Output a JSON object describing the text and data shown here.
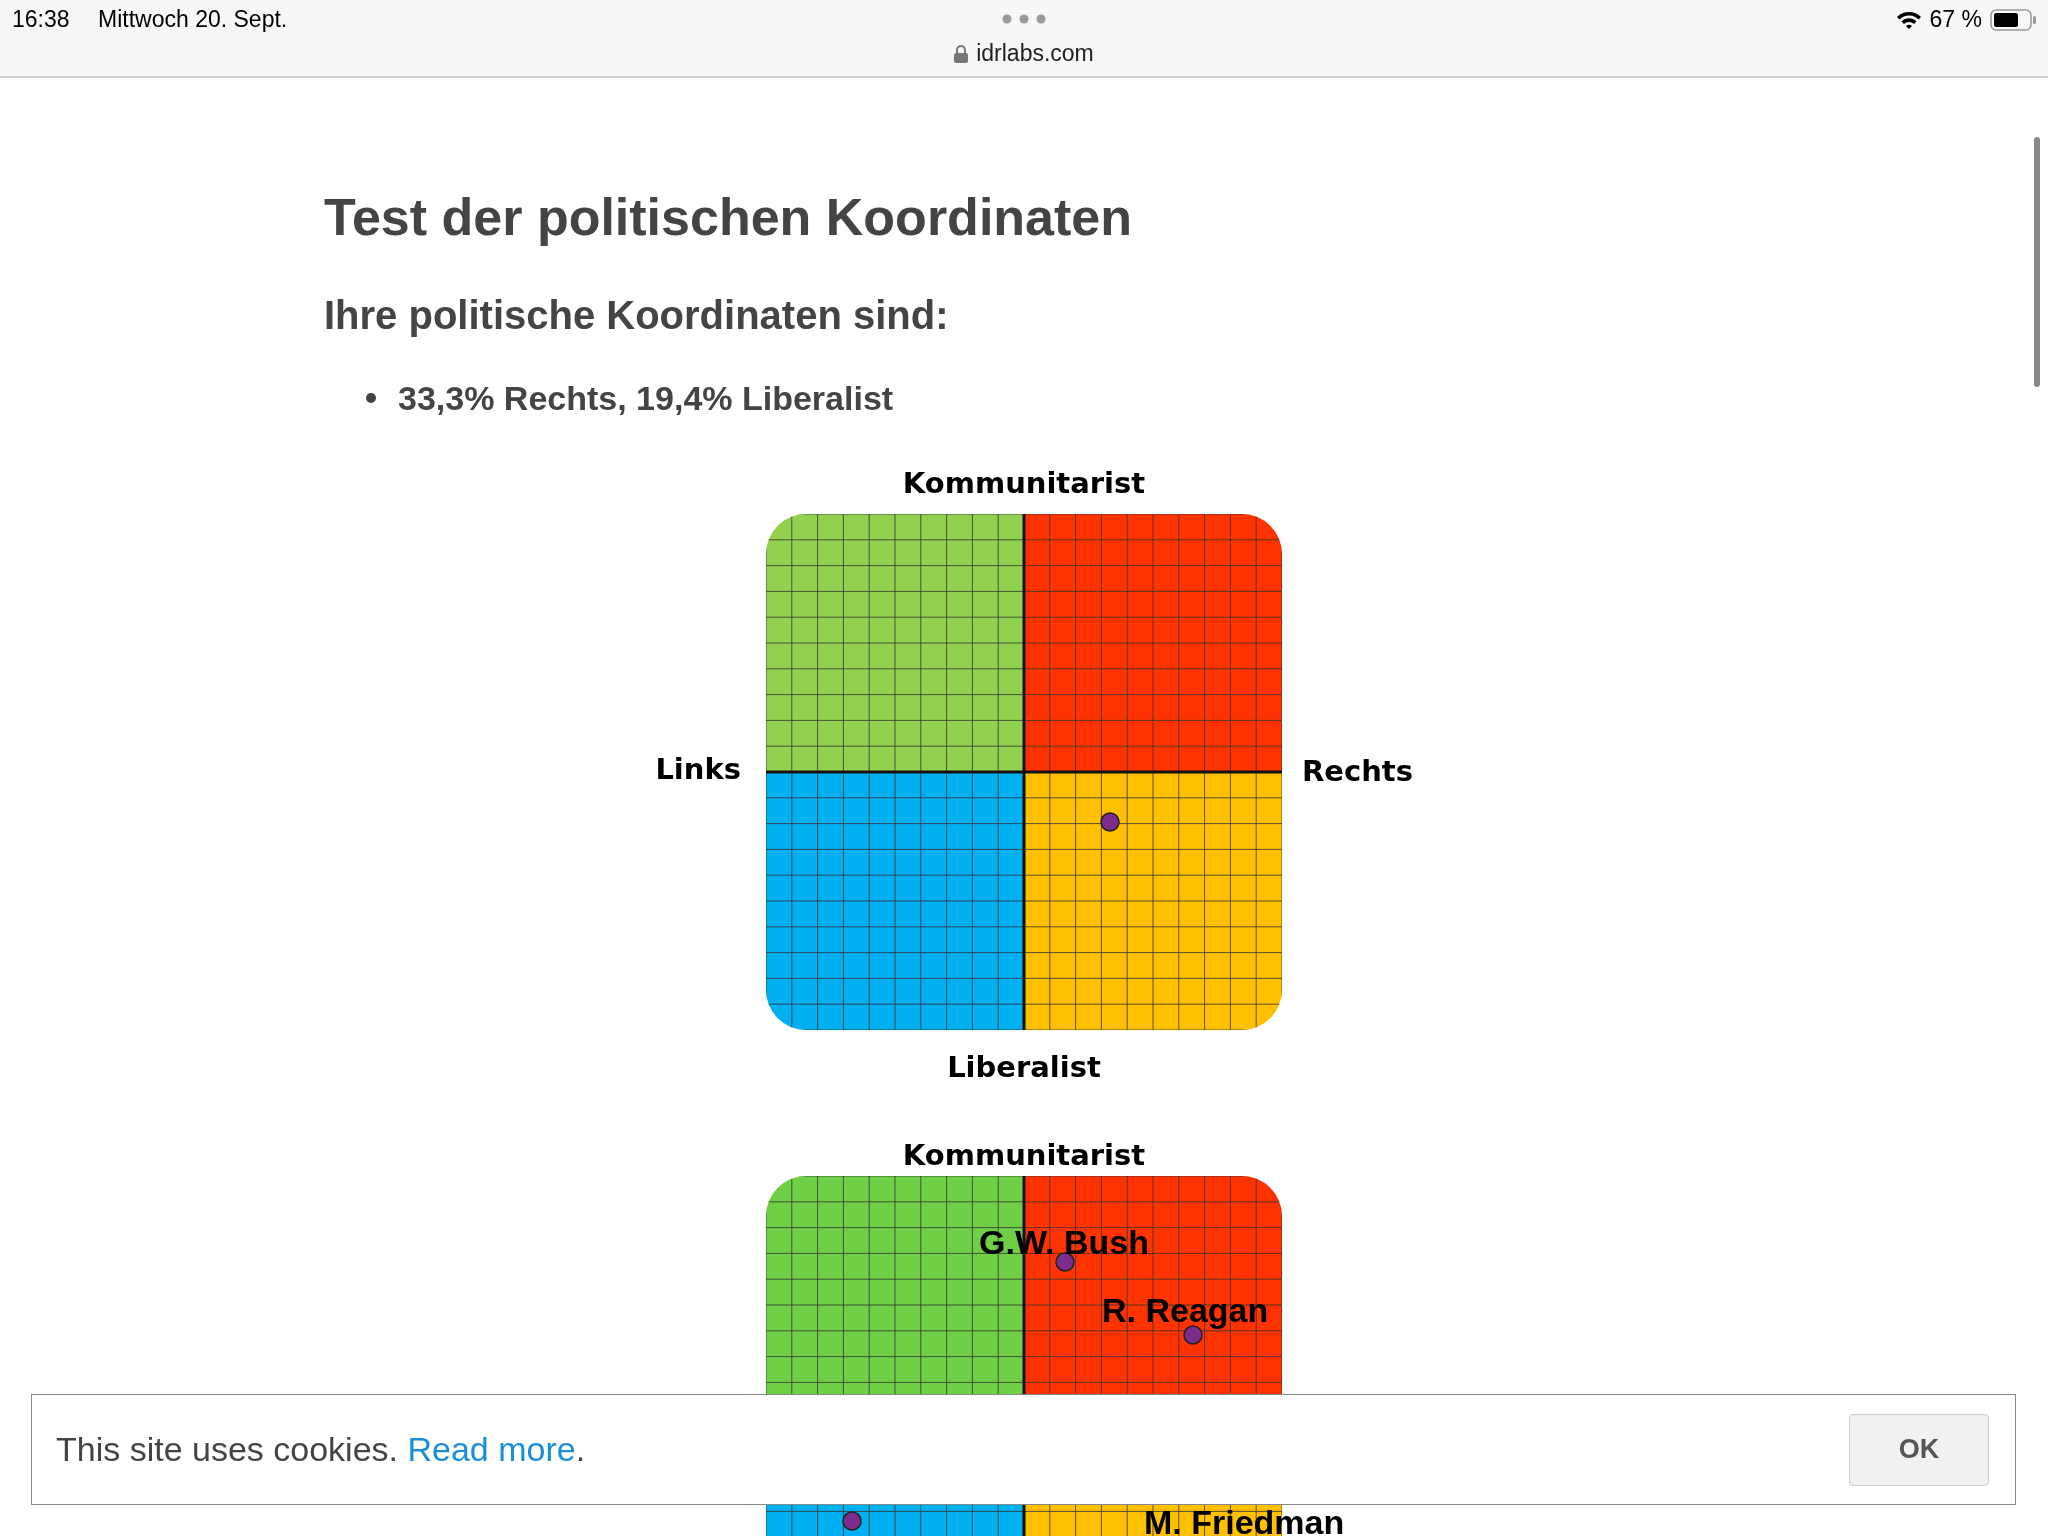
{
  "status_bar": {
    "time": "16:38",
    "date": "Mittwoch 20. Sept.",
    "url": "idrlabs.com",
    "battery": "67 %"
  },
  "page": {
    "title": "Test der politischen Koordinaten",
    "subtitle": "Ihre politische Koordinaten sind:",
    "results": [
      "33,3% Rechts, 19,4% Liberalist"
    ]
  },
  "compass": {
    "top": "Kommunitarist",
    "left": "Links",
    "right": "Rechts",
    "bottom": "Liberalist",
    "quadrants": [
      {
        "color": "#92d050"
      },
      {
        "color": "#ff3300"
      },
      {
        "color": "#00b0f0"
      },
      {
        "color": "#ffc000"
      }
    ]
  },
  "reference_compass": {
    "top": "Kommunitarist",
    "quadrants": [
      {
        "color": "#6fd046"
      },
      {
        "color": "#ff3300"
      },
      {
        "color": "#00b0f0"
      },
      {
        "color": "#ffc000"
      }
    ],
    "points": [
      {
        "label": "G.W. Bush"
      },
      {
        "label": "R. Reagan"
      },
      {
        "label": "M. Friedman"
      }
    ]
  },
  "cookie_banner": {
    "text": "This site uses cookies.",
    "link": "Read more",
    "after": ".",
    "button": "OK"
  }
}
